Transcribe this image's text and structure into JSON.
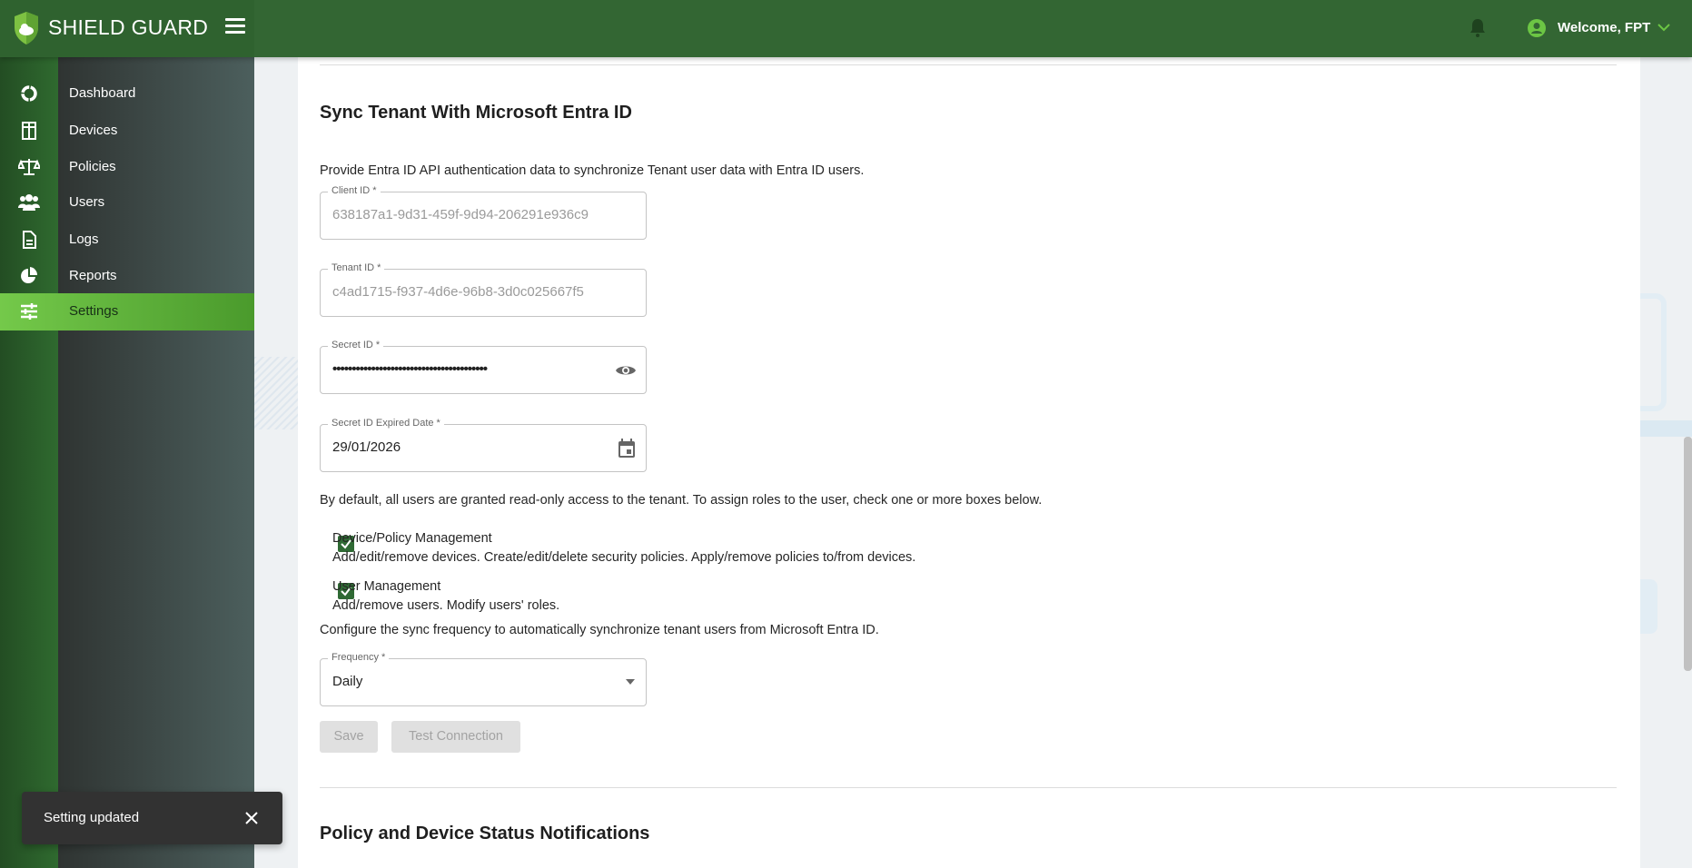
{
  "brand": {
    "name": "SHIELD GUARD",
    "primary_color": "#336633",
    "accent_color": "#6cc644"
  },
  "header": {
    "welcome": "Welcome, FPT",
    "icons": [
      "bell-icon",
      "user-circle-icon",
      "chevron-down-icon",
      "menu-icon"
    ]
  },
  "sidebar": {
    "items": [
      {
        "label": "Dashboard",
        "icon": "dashboard-icon"
      },
      {
        "label": "Devices",
        "icon": "devices-icon"
      },
      {
        "label": "Policies",
        "icon": "scale-icon"
      },
      {
        "label": "Users",
        "icon": "users-icon"
      },
      {
        "label": "Logs",
        "icon": "document-icon"
      },
      {
        "label": "Reports",
        "icon": "pie-chart-icon"
      },
      {
        "label": "Settings",
        "icon": "sliders-icon",
        "active": true
      }
    ]
  },
  "sync": {
    "title": "Sync Tenant With Microsoft Entra ID",
    "description": "Provide Entra ID API authentication data to synchronize Tenant user data with Entra ID users.",
    "client_id": {
      "label": "Client ID *",
      "value": "638187a1-9d31-459f-9d94-206291e936c9"
    },
    "tenant_id": {
      "label": "Tenant ID *",
      "value": "c4ad1715-f937-4d6e-96b8-3d0c025667f5"
    },
    "secret_id": {
      "label": "Secret ID *",
      "value": "••••••••••••••••••••••••••••••••••••••••"
    },
    "expired_date": {
      "label": "Secret ID Expired Date *",
      "value": "29/01/2026"
    },
    "roles_note": "By default, all users are granted read-only access to the tenant. To assign roles to the user, check one or more boxes below.",
    "roles": [
      {
        "title": "Device/Policy Management",
        "desc": "Add/edit/remove devices. Create/edit/delete security policies. Apply/remove policies to/from devices.",
        "checked": true
      },
      {
        "title": "User Management",
        "desc": "Add/remove users. Modify users' roles.",
        "checked": true
      }
    ],
    "frequency_note": "Configure the sync frequency to automatically synchronize tenant users from Microsoft Entra ID.",
    "frequency": {
      "label": "Frequency *",
      "value": "Daily"
    },
    "save_label": "Save",
    "test_label": "Test Connection"
  },
  "notifications": {
    "title": "Policy and Device Status Notifications"
  },
  "toast": {
    "message": "Setting updated"
  }
}
